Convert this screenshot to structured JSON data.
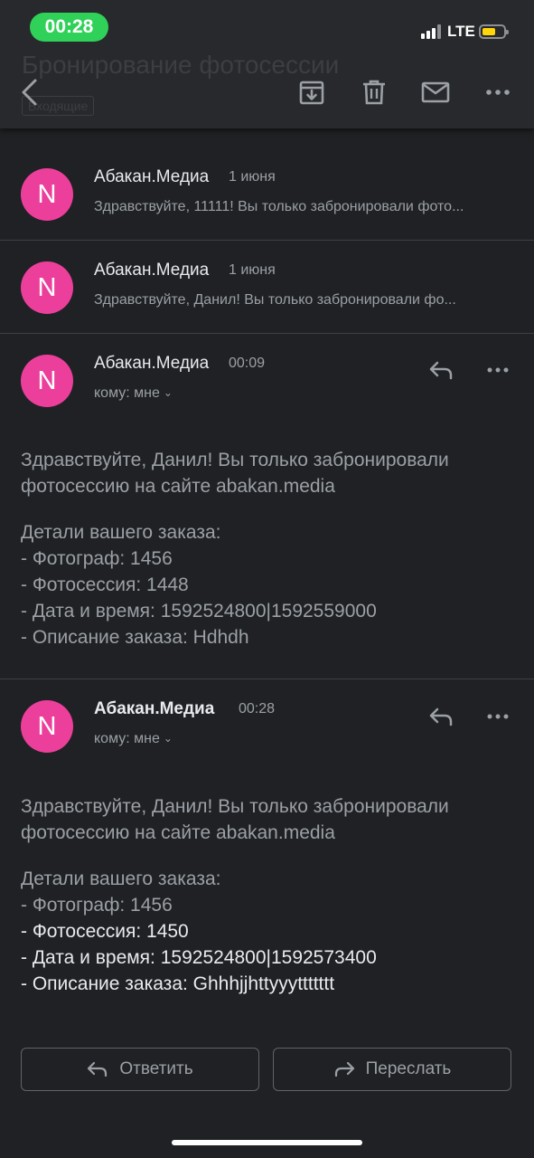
{
  "status_bar": {
    "time": "00:28",
    "network": "LTE"
  },
  "header": {
    "subject": "Бронирование фотосессии",
    "label": "Входящие"
  },
  "toolbar": {
    "icons": [
      "back-icon",
      "archive-icon",
      "trash-icon",
      "mail-icon",
      "more-icon"
    ]
  },
  "messages": [
    {
      "avatar_letter": "N",
      "sender": "Абакан.Медиа",
      "date": "1 июня",
      "snippet": "Здравствуйте, 11111! Вы только забронировали фото..."
    },
    {
      "avatar_letter": "N",
      "sender": "Абакан.Медиа",
      "date": "1 июня",
      "snippet": "Здравствуйте, Данил! Вы только забронировали фо..."
    },
    {
      "avatar_letter": "N",
      "sender": "Абакан.Медиа",
      "time": "00:09",
      "recipient": "кому: мне",
      "body": {
        "greeting": "Здравствуйте, Данил! Вы только забронировали фотосессию на сайте abakan.media",
        "details_title": "Детали вашего заказа:",
        "lines": [
          "- Фотограф: 1456",
          "- Фотосессия: 1448",
          "- Дата и время: 1592524800|1592559000",
          "- Описание заказа: Hdhdh"
        ]
      }
    },
    {
      "avatar_letter": "N",
      "sender": "Абакан.Медиа",
      "time": "00:28",
      "recipient": "кому: мне",
      "body": {
        "greeting": "Здравствуйте, Данил! Вы только забронировали фотосессию на сайте abakan.media",
        "details_title": "Детали вашего заказа:",
        "lines": [
          "- Фотограф: 1456",
          "- Фотосессия: 1450",
          "- Дата и время: 1592524800|1592573400",
          "- Описание заказа: Ghhhjjhttyyyttttttt"
        ]
      }
    }
  ],
  "actions": {
    "reply_label": "Ответить",
    "forward_label": "Переслать"
  },
  "colors": {
    "background": "#202124",
    "avatar": "#ec3f9b",
    "status_pill": "#30d158",
    "battery": "#ffd60a"
  }
}
